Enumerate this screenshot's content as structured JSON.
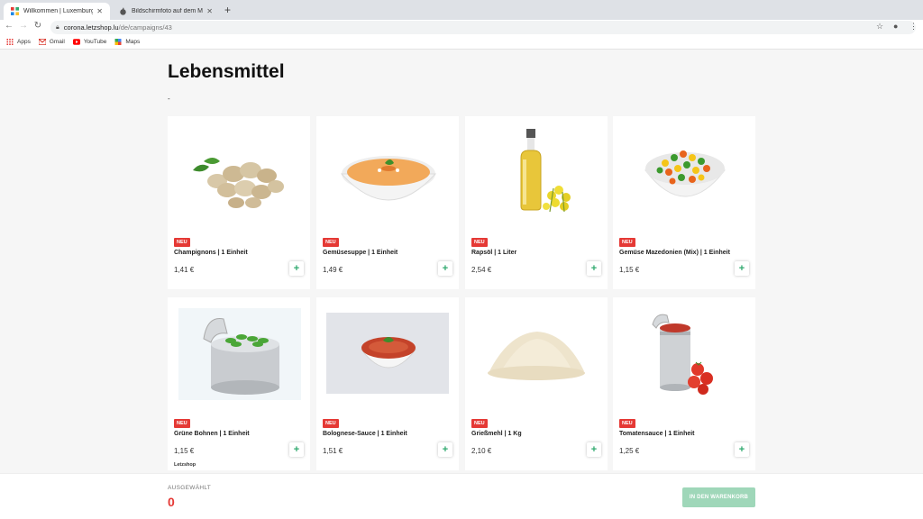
{
  "browser": {
    "tabs": [
      {
        "title": "Willkommen | Luxemburg",
        "active": true
      },
      {
        "title": "Bildschirmfoto auf dem Mac e...",
        "active": false
      }
    ],
    "address": {
      "host": "corona.letzshop.lu",
      "path": "/de/campaigns/43"
    },
    "bookmarks": [
      {
        "label": "Apps",
        "icon": "apps-grid-icon"
      },
      {
        "label": "Gmail",
        "icon": "gmail-icon"
      },
      {
        "label": "YouTube",
        "icon": "youtube-icon"
      },
      {
        "label": "Maps",
        "icon": "maps-icon"
      }
    ]
  },
  "page": {
    "title": "Lebensmittel",
    "subtitle": "-"
  },
  "products": [
    {
      "badge": "NEU",
      "name": "Champignons | 1 Einheit",
      "price": "1,41 €",
      "icon": "mushrooms-image"
    },
    {
      "badge": "NEU",
      "name": "Gemüsesuppe | 1 Einheit",
      "price": "1,49 €",
      "icon": "soup-image"
    },
    {
      "badge": "NEU",
      "name": "Rapsöl | 1 Liter",
      "price": "2,54 €",
      "icon": "oil-bottle-image"
    },
    {
      "badge": "NEU",
      "name": "Gemüse Mazedonien (Mix) | 1 Einheit",
      "price": "1,15 €",
      "icon": "mixed-vegetables-image"
    },
    {
      "badge": "NEU",
      "name": "Grüne Bohnen | 1 Einheit",
      "price": "1,15 €",
      "icon": "green-beans-can-image",
      "extra": "Letzshop"
    },
    {
      "badge": "NEU",
      "name": "Bolognese-Sauce | 1 Einheit",
      "price": "1,51 €",
      "icon": "bolognese-image"
    },
    {
      "badge": "NEU",
      "name": "Grießmehl | 1 Kg",
      "price": "2,10 €",
      "icon": "semolina-image"
    },
    {
      "badge": "NEU",
      "name": "Tomatensauce | 1 Einheit",
      "price": "1,25 €",
      "icon": "tomato-can-image"
    }
  ],
  "add_label": "+",
  "footer": {
    "selected_label": "AUSGEWÄHLT",
    "selected_count": "0",
    "cart_button": "IN DEN WARENKORB"
  },
  "colors": {
    "accent": "#2ea86d",
    "badge": "#e53935",
    "cart_button": "#9fd7b9"
  }
}
